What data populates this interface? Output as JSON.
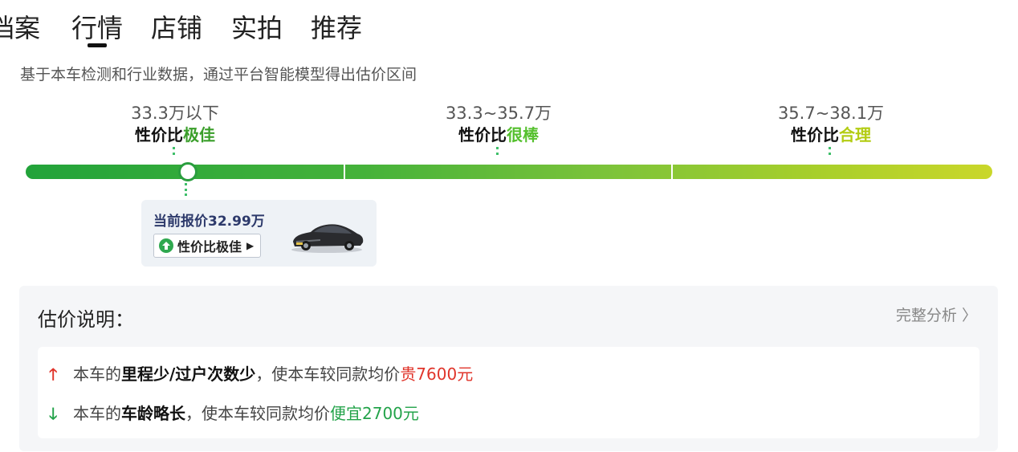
{
  "tabs": [
    {
      "label": "档案"
    },
    {
      "label": "行情"
    },
    {
      "label": "店铺"
    },
    {
      "label": "实拍"
    },
    {
      "label": "推荐"
    }
  ],
  "active_tab": "行情",
  "subtitle": "基于本车检测和行业数据，通过平台智能模型得出估价区间",
  "segments": [
    {
      "range": "33.3万以下",
      "prefix": "性价比",
      "rating": "极佳",
      "color": "#3a9e2a"
    },
    {
      "range": "33.3~35.7万",
      "prefix": "性价比",
      "rating": "很棒",
      "color": "#55c02e"
    },
    {
      "range": "35.7~38.1万",
      "prefix": "性价比",
      "rating": "合理",
      "color": "#b3cc12"
    }
  ],
  "current_price": {
    "label": "当前报价32.99万",
    "badge": "性价比极佳",
    "badge_arrow": "▶"
  },
  "explanation": {
    "title": "估价说明：",
    "full_analysis": "完整分析",
    "full_analysis_chevron": "〉",
    "items": [
      {
        "direction": "up",
        "arrow": "🡑",
        "prefix": "本车的",
        "bold": "里程少/过户次数少",
        "middle": "，使本车较同款均价",
        "amount": "贵7600元"
      },
      {
        "direction": "down",
        "arrow": "🡓",
        "prefix": "本车的",
        "bold": "车龄略长",
        "middle": "，使本车较同款均价",
        "amount": "便宜2700元"
      }
    ]
  },
  "colors": {
    "bar_start": "#22a33a",
    "bar_end": "#cad72a",
    "up": "#e0342a",
    "down": "#23a34a"
  }
}
